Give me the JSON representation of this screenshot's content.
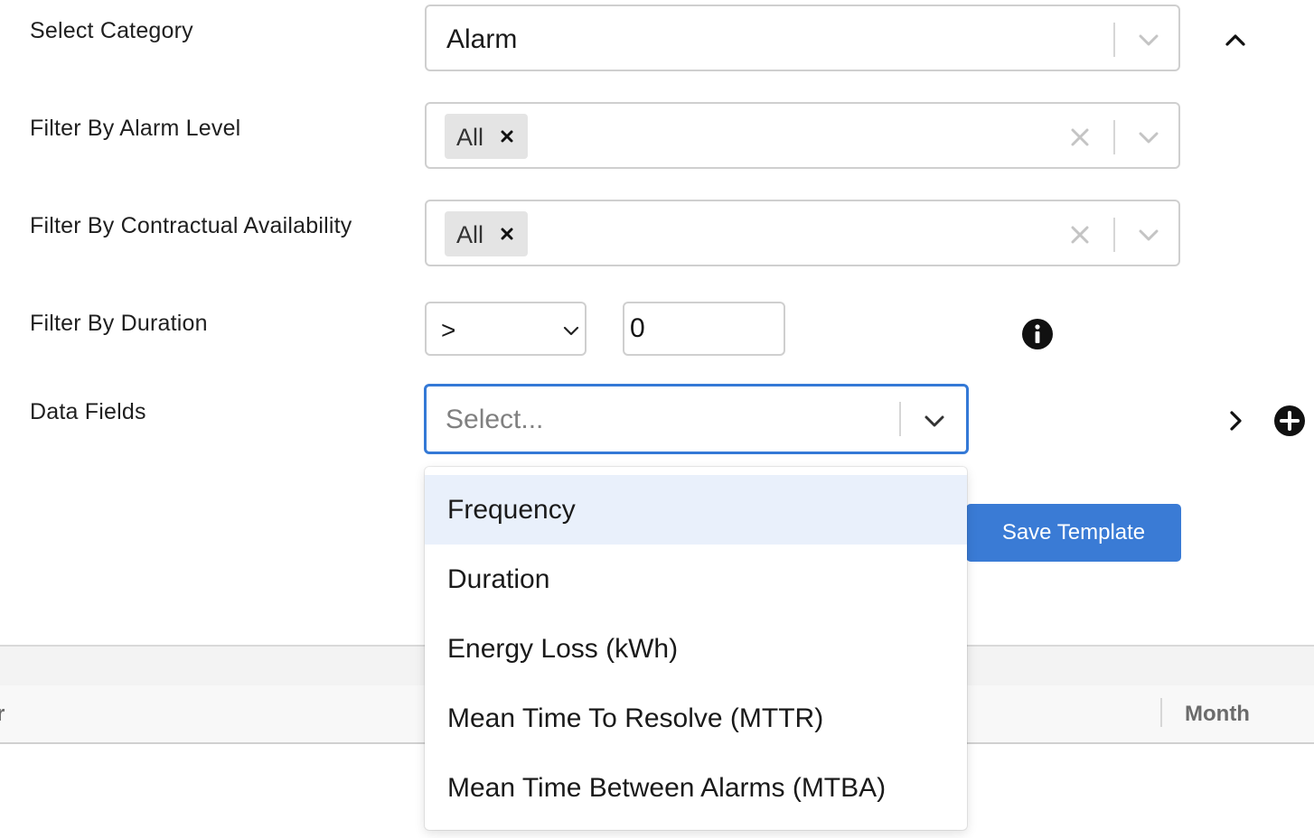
{
  "form": {
    "category": {
      "label": "Select Category",
      "value": "Alarm"
    },
    "alarm_level": {
      "label": "Filter By Alarm Level",
      "chip": "All"
    },
    "contractual": {
      "label": "Filter By Contractual Availability",
      "chip": "All"
    },
    "duration": {
      "label": "Filter By Duration",
      "operator": ">",
      "value": "0"
    },
    "data_fields": {
      "label": "Data Fields",
      "placeholder": "Select..."
    }
  },
  "dropdown": {
    "options": [
      "Frequency",
      "Duration",
      "Energy Loss (kWh)",
      "Mean Time To Resolve (MTTR)",
      "Mean Time Between Alarms (MTBA)"
    ],
    "highlighted_index": 0
  },
  "actions": {
    "save_label": "Save Template"
  },
  "table": {
    "columns": [
      "r",
      "Month"
    ]
  },
  "colors": {
    "accent": "#3a7bd5",
    "focus_border": "#3479d6",
    "highlight": "#e9f0fb"
  },
  "icons": [
    "chevron-up-icon",
    "chevron-down-icon",
    "clear-icon",
    "remove-chip-icon",
    "info-icon",
    "chevron-right-icon",
    "plus-circle-icon"
  ]
}
